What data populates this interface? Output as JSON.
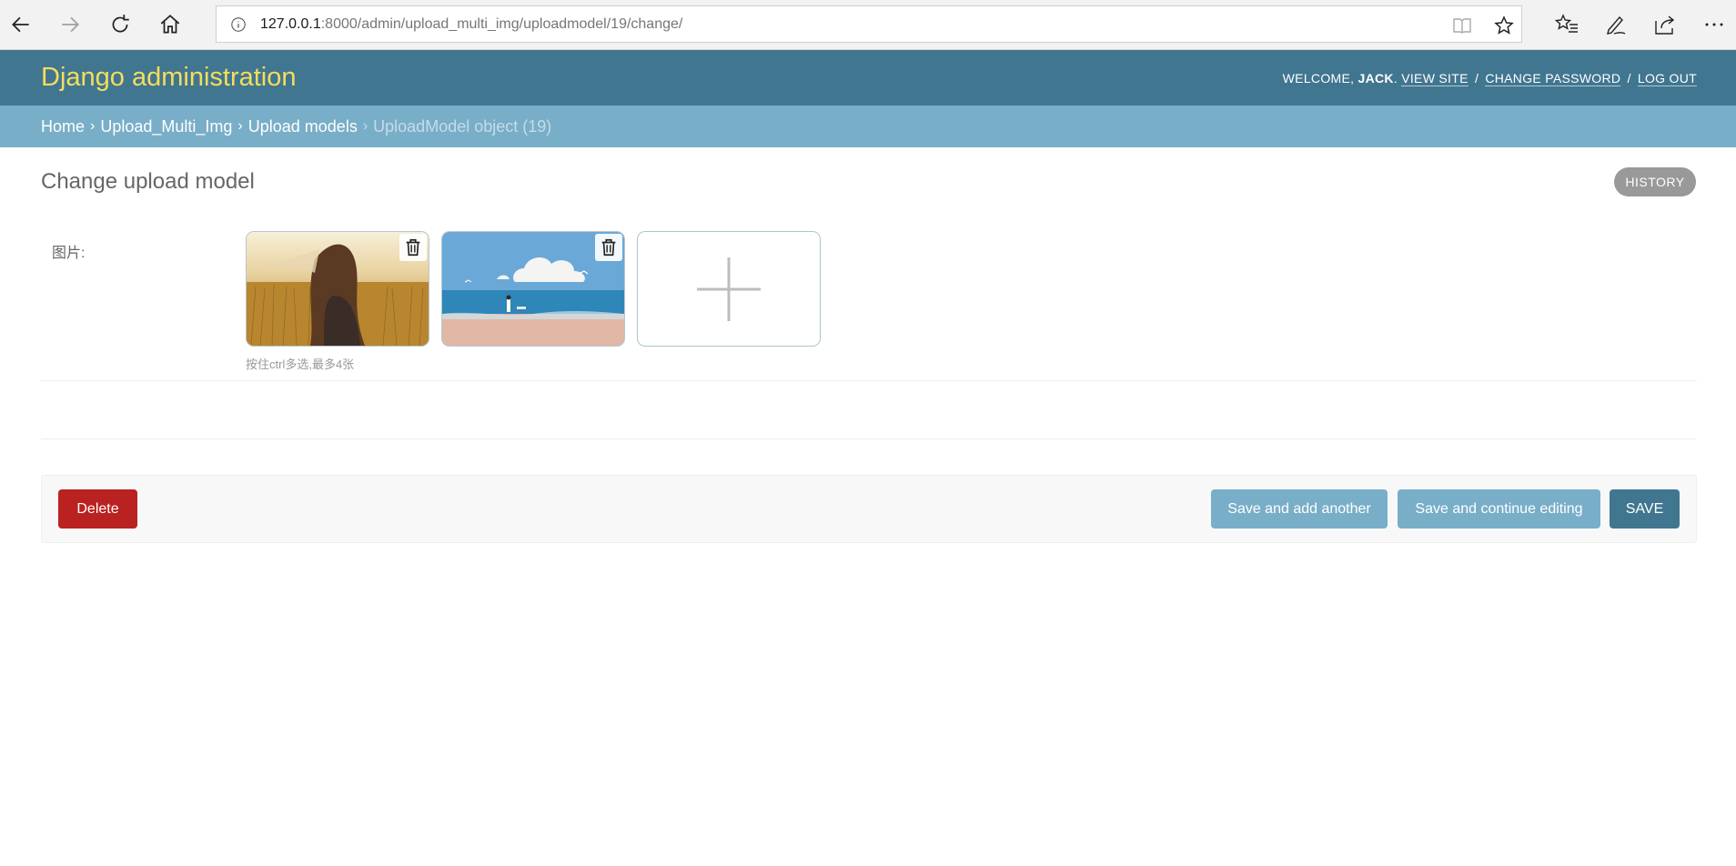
{
  "browser": {
    "address_host": "127.0.0.1",
    "address_rest": ":8000/admin/upload_multi_img/uploadmodel/19/change/"
  },
  "header": {
    "branding": "Django administration",
    "welcome": "WELCOME,",
    "username": "JACK",
    "view_site": "VIEW SITE",
    "change_password": "CHANGE PASSWORD",
    "log_out": "LOG OUT",
    "sep": "/"
  },
  "breadcrumbs": {
    "home": "Home",
    "app": "Upload_Multi_Img",
    "model": "Upload models",
    "current": "UploadModel object (19)",
    "sep": "›"
  },
  "page": {
    "title": "Change upload model",
    "history": "HISTORY"
  },
  "form": {
    "field_label": "图片:",
    "help_text": "按住ctrl多选,最多4张",
    "images": [
      {
        "icon": "trash-icon"
      },
      {
        "icon": "trash-icon"
      }
    ],
    "add_icon": "plus-icon"
  },
  "actions": {
    "delete": "Delete",
    "save_add_another": "Save and add another",
    "save_continue": "Save and continue editing",
    "save": "SAVE"
  },
  "colors": {
    "header_bg": "#417690",
    "branding": "#f5dd5d",
    "breadcrumbs_bg": "#79aec8",
    "delete_bg": "#ba2121",
    "secondary_btn": "#79aec8",
    "primary_btn": "#417690"
  }
}
